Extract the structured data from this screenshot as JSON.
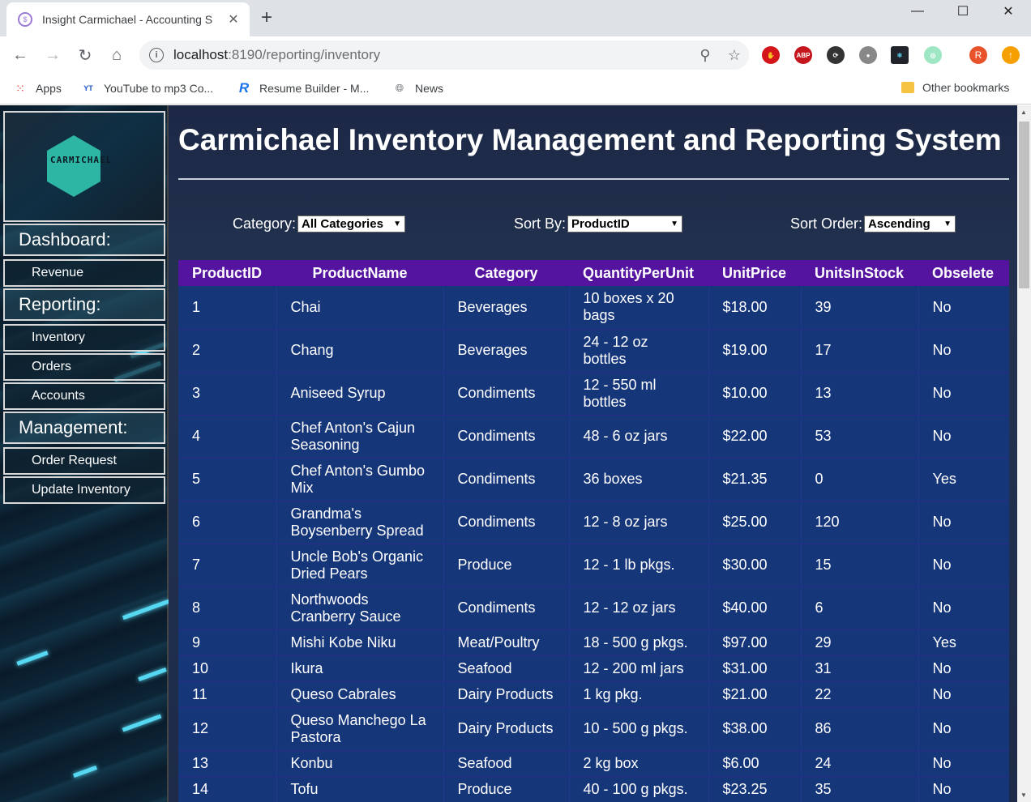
{
  "browser": {
    "tab_title": "Insight Carmichael - Accounting S",
    "url_host": "localhost",
    "url_rest": ":8190/reporting/inventory",
    "bookmarks": [
      "Apps",
      "YouTube to mp3 Co...",
      "Resume Builder - M...",
      "News"
    ],
    "other_bookmarks": "Other bookmarks",
    "profile_initial": "R",
    "ext_abp": "ABP"
  },
  "sidebar": {
    "logo_text": "CARMICHAEL",
    "sections": [
      {
        "title": "Dashboard:",
        "items": [
          "Revenue"
        ]
      },
      {
        "title": "Reporting:",
        "items": [
          "Inventory",
          "Orders",
          "Accounts"
        ]
      },
      {
        "title": "Management:",
        "items": [
          "Order Request",
          "Update Inventory"
        ]
      }
    ]
  },
  "main": {
    "title": "Carmichael Inventory Management and Reporting System",
    "filters": {
      "category_label": "Category:",
      "category_value": "All Categories",
      "sortby_label": "Sort By:",
      "sortby_value": "ProductID",
      "sortorder_label": "Sort Order:",
      "sortorder_value": "Ascending"
    },
    "table": {
      "headers": [
        "ProductID",
        "ProductName",
        "Category",
        "QuantityPerUnit",
        "UnitPrice",
        "UnitsInStock",
        "Obselete"
      ],
      "rows": [
        [
          "1",
          "Chai",
          "Beverages",
          "10 boxes x 20 bags",
          "$18.00",
          "39",
          "No"
        ],
        [
          "2",
          "Chang",
          "Beverages",
          "24 - 12 oz bottles",
          "$19.00",
          "17",
          "No"
        ],
        [
          "3",
          "Aniseed Syrup",
          "Condiments",
          "12 - 550 ml bottles",
          "$10.00",
          "13",
          "No"
        ],
        [
          "4",
          "Chef Anton's Cajun Seasoning",
          "Condiments",
          "48 - 6 oz jars",
          "$22.00",
          "53",
          "No"
        ],
        [
          "5",
          "Chef Anton's Gumbo Mix",
          "Condiments",
          "36 boxes",
          "$21.35",
          "0",
          "Yes"
        ],
        [
          "6",
          "Grandma's Boysenberry Spread",
          "Condiments",
          "12 - 8 oz jars",
          "$25.00",
          "120",
          "No"
        ],
        [
          "7",
          "Uncle Bob's Organic Dried Pears",
          "Produce",
          "12 - 1 lb pkgs.",
          "$30.00",
          "15",
          "No"
        ],
        [
          "8",
          "Northwoods Cranberry Sauce",
          "Condiments",
          "12 - 12 oz jars",
          "$40.00",
          "6",
          "No"
        ],
        [
          "9",
          "Mishi Kobe Niku",
          "Meat/Poultry",
          "18 - 500 g pkgs.",
          "$97.00",
          "29",
          "Yes"
        ],
        [
          "10",
          "Ikura",
          "Seafood",
          "12 - 200 ml jars",
          "$31.00",
          "31",
          "No"
        ],
        [
          "11",
          "Queso Cabrales",
          "Dairy Products",
          "1 kg pkg.",
          "$21.00",
          "22",
          "No"
        ],
        [
          "12",
          "Queso Manchego La Pastora",
          "Dairy Products",
          "10 - 500 g pkgs.",
          "$38.00",
          "86",
          "No"
        ],
        [
          "13",
          "Konbu",
          "Seafood",
          "2 kg box",
          "$6.00",
          "24",
          "No"
        ],
        [
          "14",
          "Tofu",
          "Produce",
          "40 - 100 g pkgs.",
          "$23.25",
          "35",
          "No"
        ]
      ]
    }
  }
}
